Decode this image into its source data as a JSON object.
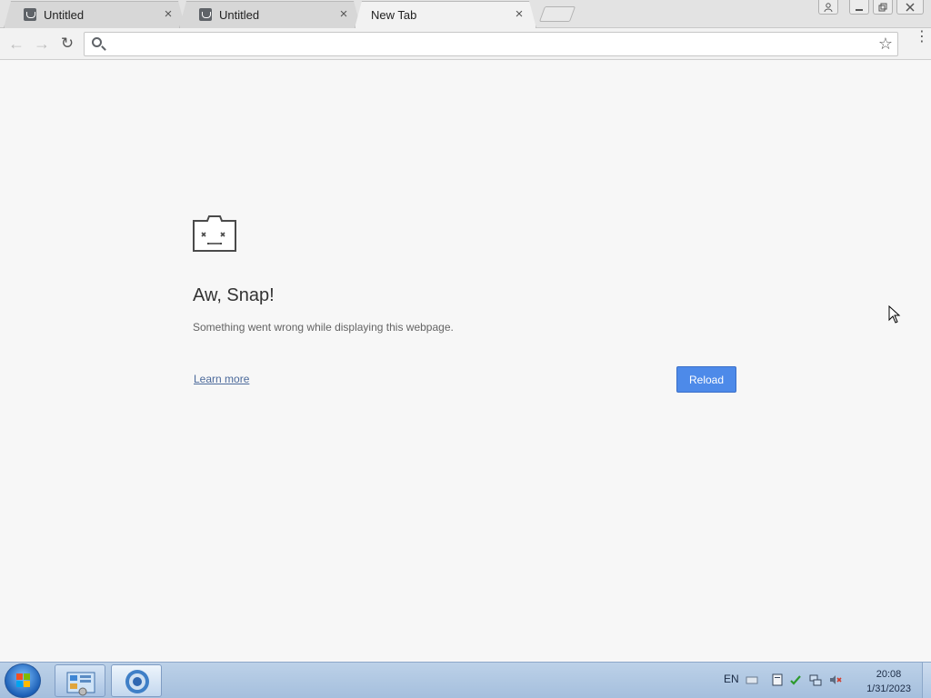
{
  "tabs": [
    {
      "title": "Untitled",
      "active": false,
      "icon": "sad-page-icon"
    },
    {
      "title": "Untitled",
      "active": false,
      "icon": "sad-page-icon"
    },
    {
      "title": "New Tab",
      "active": true,
      "icon": ""
    }
  ],
  "toolbar": {
    "back": "←",
    "forward": "→",
    "reload": "↻",
    "omnibox_value": "",
    "star": "☆",
    "menu": "⋮"
  },
  "window_controls": {
    "profile": "👤",
    "minimize": "—",
    "maximize": "❐",
    "close": "✕"
  },
  "error_page": {
    "title": "Aw, Snap!",
    "description": "Something went wrong while displaying this webpage.",
    "learn_more": "Learn more",
    "reload_button": "Reload"
  },
  "taskbar": {
    "language": "EN",
    "time": "20:08",
    "date": "1/31/2023"
  },
  "colors": {
    "reload_button": "#4d8ae9",
    "link": "#4c6a9b",
    "taskbar": "#a5bfdd"
  }
}
